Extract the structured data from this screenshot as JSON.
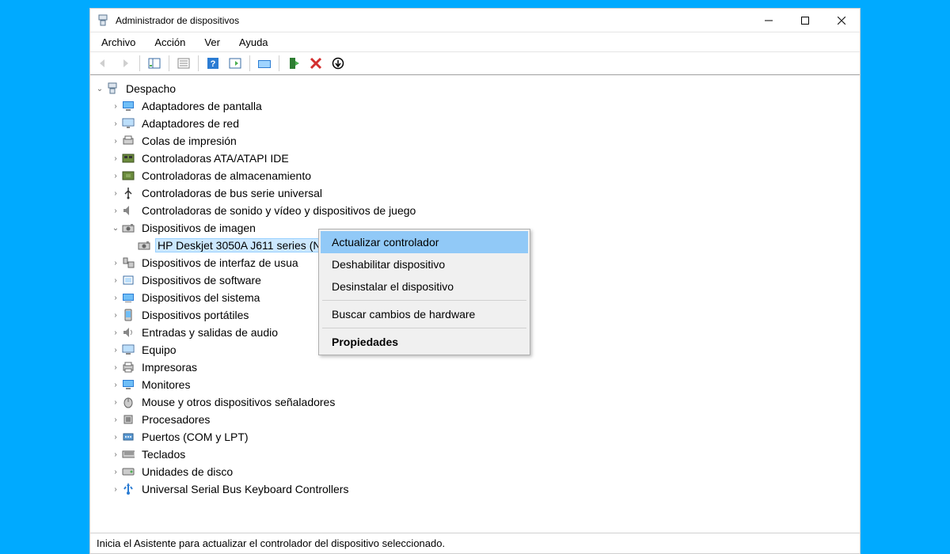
{
  "window_title": "Administrador de dispositivos",
  "menu": {
    "file": "Archivo",
    "action": "Acción",
    "view": "Ver",
    "help": "Ayuda"
  },
  "tree": {
    "root": "Despacho",
    "items": [
      "Adaptadores de pantalla",
      "Adaptadores de red",
      "Colas de impresión",
      "Controladoras ATA/ATAPI IDE",
      "Controladoras de almacenamiento",
      "Controladoras de bus serie universal",
      "Controladoras de sonido y vídeo y dispositivos de juego",
      "Dispositivos de imagen",
      "Dispositivos de interfaz de usua",
      "Dispositivos de software",
      "Dispositivos del sistema",
      "Dispositivos portátiles",
      "Entradas y salidas de audio",
      "Equipo",
      "Impresoras",
      "Monitores",
      "Mouse y otros dispositivos señaladores",
      "Procesadores",
      "Puertos (COM y LPT)",
      "Teclados",
      "Unidades de disco",
      "Universal Serial Bus Keyboard Controllers"
    ],
    "selected_child": "HP Deskjet 3050A J611 series (NET)"
  },
  "context_menu": {
    "update": "Actualizar controlador",
    "disable": "Deshabilitar dispositivo",
    "uninstall": "Desinstalar el dispositivo",
    "scan": "Buscar cambios de hardware",
    "properties": "Propiedades"
  },
  "statusbar": "Inicia el Asistente para actualizar el controlador del dispositivo seleccionado."
}
